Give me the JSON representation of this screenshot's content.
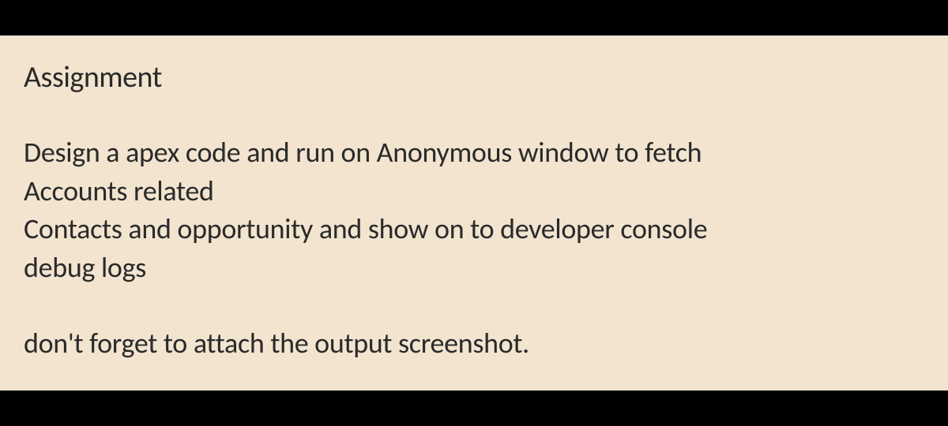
{
  "document": {
    "title": "Assignment",
    "paragraph1_line1": "Design a apex code and run on Anonymous window to fetch",
    "paragraph1_line2": "Accounts related",
    "paragraph1_line3": "Contacts and opportunity and show on to developer console",
    "paragraph1_line4": "debug logs",
    "paragraph2": "don't forget to attach the output screenshot."
  }
}
